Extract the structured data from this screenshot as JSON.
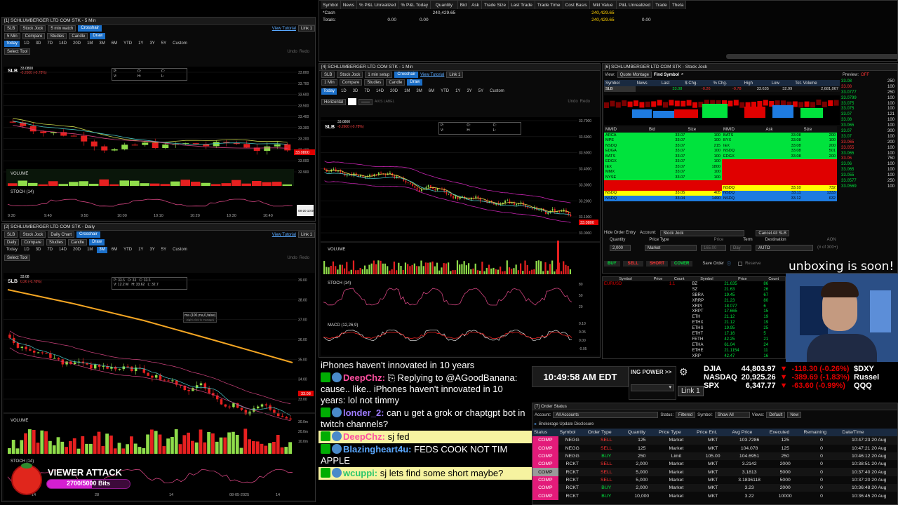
{
  "positions": {
    "headers": [
      "Symbol",
      "News",
      "% P&L Unrealized",
      "% P&L Today",
      "Quantity",
      "Bid",
      "Ask",
      "Trade Size",
      "Last Trade",
      "Trade Time",
      "Cost Basis",
      "Mkt Value",
      "P&L Unrealized",
      "Trade",
      "Theta"
    ],
    "rows": [
      {
        "symbol": "*Cash",
        "qty": "240,429.65",
        "mkt": "240,429.65",
        "pl": ""
      },
      {
        "symbol": "Totals:",
        "pu": "0.00",
        "pt": "0.00",
        "mkt": "240,429.65",
        "pl": "0.00"
      }
    ]
  },
  "chart1": {
    "title": "[1] SCHLUMBERGER LTD COM STK - 5 Min",
    "symbol": "SLB",
    "setup": "Stock Jock",
    "interval": "5 min watch",
    "crosshair": "Crosshair",
    "tutorial": "View Tutorial",
    "link": "Link 1",
    "tb2": [
      "5 Min",
      "Compare",
      "Studies",
      "Candle",
      "Draw"
    ],
    "tfs": [
      "Today",
      "1D",
      "3D",
      "7D",
      "14D",
      "20D",
      "1M",
      "3M",
      "6M",
      "YTD",
      "1Y",
      "3Y",
      "5Y",
      "Custom"
    ],
    "select_tool": "Select Tool",
    "undo": "Undo",
    "redo": "Redo",
    "price": "33.0800",
    "change": "-0.2600 (-0.78%)",
    "ohlc": [
      "P:",
      "O:",
      "C:",
      "V:",
      "H:",
      "L:"
    ],
    "yticks": [
      "33.800",
      "33.700",
      "33.600",
      "33.500",
      "33.400",
      "33.300",
      "33.200",
      "33.100",
      "33.000",
      "32.900"
    ],
    "last": "33.0800",
    "volume_label": "VOLUME",
    "stoch_label": "STOCH (14)",
    "xticks": [
      "9:30",
      "9:40",
      "9:50",
      "10:00",
      "10:10",
      "10:20",
      "10:30",
      "10:40"
    ],
    "time_badge": "08-20 10:50"
  },
  "chart2": {
    "title": "[2] SCHLUMBERGER LTD COM STK - Daily",
    "symbol": "SLB",
    "setup": "Stock Jock",
    "interval": "Daily Chart",
    "crosshair": "Crosshair",
    "tutorial": "View Tutorial",
    "link": "Link 1",
    "tb2": [
      "Daily",
      "Compare",
      "Studies",
      "Candle",
      "Draw"
    ],
    "tfs": [
      "Today",
      "1D",
      "3D",
      "7D",
      "14D",
      "20D",
      "1M",
      "3M",
      "6M",
      "YTD",
      "1Y",
      "3Y",
      "5Y",
      "Custom"
    ],
    "select_tool": "Select Tool",
    "undo": "Undo",
    "redo": "Redo",
    "price": "33.08",
    "change": "0.26 (-0.78%)",
    "ohlc": "P: 33.5   O: 33   C: 33.5\nV: 12.2 M   H: 33.62   L: 32.7",
    "ma_label": "ma (100,ma,0,false)",
    "ma_hint": "(right-click to manage)",
    "yticks": [
      "39.00",
      "38.00",
      "37.00",
      "36.00",
      "35.00",
      "34.00",
      "33.00"
    ],
    "last": "33.08",
    "volume_label": "VOLUME",
    "stoch_label": "STOCH (14)",
    "vol_ticks": [
      "30.0m",
      "20.0m",
      "10.0m"
    ],
    "xticks": [
      "14",
      "28",
      "14",
      "08-05-2025",
      "14"
    ]
  },
  "chart4": {
    "title": "[4] SCHLUMBERGER LTD COM STK - 1 Min",
    "symbol": "SLB",
    "setup": "Stock Jock",
    "interval": "1 min setup",
    "crosshair": "Crosshair",
    "tutorial": "View Tutorial",
    "link": "Link 1",
    "tb2": [
      "1 Min",
      "Compare",
      "Studies",
      "Candle",
      "Draw"
    ],
    "tfs": [
      "Today",
      "1D",
      "3D",
      "7D",
      "14D",
      "20D",
      "1M",
      "3M",
      "6M",
      "YTD",
      "1Y",
      "3Y",
      "5Y",
      "Custom"
    ],
    "line_style": "Horizontal",
    "axis_label": "AXIS LABEL",
    "undo": "Undo",
    "redo": "Redo",
    "price": "33.0800",
    "change": "-0.2600 (-0.78%)",
    "ohlc": [
      "P:",
      "O:",
      "C:",
      "V:",
      "H:",
      "L:"
    ],
    "yticks": [
      "33.7000",
      "33.6000",
      "33.5000",
      "33.4000",
      "33.3000",
      "33.2000",
      "33.1000",
      "33.0000"
    ],
    "last": "33.0800",
    "volume_label": "VOLUME",
    "stoch_label": "STOCH (14)",
    "macd_label": "MACD (12,26,9)",
    "stoch_ticks": [
      "80",
      "50",
      "20"
    ],
    "macd_ticks": [
      "0.10",
      "0.05",
      "0.00",
      "-0.05"
    ]
  },
  "level2": {
    "title": "[6] SCHLUMBERGER LTD COM STK - Stock Jock",
    "view": "Quote Montage",
    "find": "Find Symbol",
    "preview": "Preview:",
    "preview_state": "OFF",
    "quote_headers": [
      "Symbol",
      "News",
      "Last",
      "$ Chg.",
      "% Chg.",
      "High",
      "Low",
      "Tot. Volume"
    ],
    "quote": {
      "symbol": "SLB",
      "last": "33.08",
      "chg": "-0.26",
      "pct": "-0.78",
      "high": "33.635",
      "low": "32.99",
      "vol": "2,681,067"
    },
    "bid_headers": [
      "MMID",
      "Bid",
      "Size"
    ],
    "ask_headers": [
      "MMID",
      "Ask",
      "Size"
    ],
    "bids": [
      [
        "ARCA",
        "33.07",
        "100"
      ],
      [
        "MPE",
        "33.07",
        "100"
      ],
      [
        "NSDQ",
        "33.07",
        "215"
      ],
      [
        "EDGA",
        "33.07",
        "100"
      ],
      [
        "BATS",
        "33.07",
        "100"
      ],
      [
        "EDGX",
        "33.07",
        "100"
      ],
      [
        "IEX",
        "33.07",
        "1800"
      ],
      [
        "MMX",
        "33.07",
        "100"
      ],
      [
        "NYSE",
        "33.07",
        "100"
      ],
      [
        "",
        "",
        ""
      ],
      [
        "",
        "",
        ""
      ],
      [
        "NSDQ",
        "33.05",
        "405"
      ],
      [
        "NSDQ",
        "33.04",
        "1490"
      ]
    ],
    "asks": [
      [
        "BATS",
        "33.08",
        "200"
      ],
      [
        "BYX",
        "33.08",
        "100"
      ],
      [
        "IEX",
        "33.08",
        "200"
      ],
      [
        "NSDQ",
        "33.08",
        "501"
      ],
      [
        "EDGX",
        "33.08",
        "200"
      ],
      [
        "",
        "",
        ""
      ],
      [
        "",
        "",
        ""
      ],
      [
        "",
        "",
        ""
      ],
      [
        "",
        "",
        ""
      ],
      [
        "",
        "",
        ""
      ],
      [
        "NSDQ",
        "33.10",
        "732"
      ],
      [
        "NSDQ",
        "33.11",
        "1333"
      ],
      [
        "NSDQ",
        "33.12",
        "632"
      ]
    ],
    "ticks": [
      [
        "33.08",
        "250"
      ],
      [
        "33.08",
        "100"
      ],
      [
        "33.0777",
        "250"
      ],
      [
        "33.0799",
        "100"
      ],
      [
        "33.075",
        "100"
      ],
      [
        "33.075",
        "100"
      ],
      [
        "33.07",
        "121"
      ],
      [
        "33.08",
        "100"
      ],
      [
        "33.065",
        "100"
      ],
      [
        "33.07",
        "300"
      ],
      [
        "33.07",
        "100"
      ],
      [
        "33.065",
        "200"
      ],
      [
        "33.055",
        "100"
      ],
      [
        "33.065",
        "100"
      ],
      [
        "33.06",
        "750"
      ],
      [
        "33.06",
        "100"
      ],
      [
        "33.065",
        "100"
      ],
      [
        "33.055",
        "100"
      ],
      [
        "33.0577",
        "250"
      ],
      [
        "33.0569",
        "100"
      ]
    ],
    "entry": {
      "hide": "Hide Order Entry",
      "account_label": "Account:",
      "account": "Stock Jock",
      "cancel": "Cancel All SLB",
      "qty_label": "Quantity",
      "qty": "2,000",
      "ptype_label": "Price Type",
      "ptype": "Market",
      "price_label": "Price",
      "price": "165.00",
      "term_label": "Term",
      "term": "Day",
      "dest_label": "Destination",
      "dest": "AUTO",
      "aon": "AON",
      "of": "(# of 300+)",
      "buy": "BUY",
      "sell": "SELL",
      "short": "SHORT",
      "cover": "COVER",
      "save": "Save Order",
      "reserve": "Reserve"
    }
  },
  "watch": {
    "headers": [
      "Symbol",
      "Price",
      "Count",
      "Symbol",
      "Price",
      "Count"
    ],
    "left": [
      [
        "EURUSD",
        "",
        "1.1"
      ],
      [
        "",
        "",
        ""
      ],
      [
        "",
        "",
        ""
      ],
      [
        "",
        "",
        ""
      ],
      [
        "",
        "",
        ""
      ],
      [
        "",
        "",
        ""
      ],
      [
        "",
        "",
        ""
      ],
      [
        "",
        "",
        ""
      ],
      [
        "",
        "",
        ""
      ],
      [
        "",
        "",
        ""
      ],
      [
        "",
        "",
        ""
      ],
      [
        "",
        "",
        ""
      ],
      [
        "",
        "",
        ""
      ],
      [
        "",
        "",
        ""
      ],
      [
        "",
        "",
        ""
      ]
    ],
    "right": [
      [
        "BZ",
        "21.635",
        "86"
      ],
      [
        "SZ",
        "21.63",
        "26"
      ],
      [
        "SBRA",
        "19.45",
        "67"
      ],
      [
        "XRRP",
        "21.23",
        "80"
      ],
      [
        "XRPI",
        "18.077",
        "6"
      ],
      [
        "XRPT",
        "17.665",
        "15"
      ],
      [
        "ETH",
        "21.12",
        "19"
      ],
      [
        "ETHX",
        "21.12",
        "19"
      ],
      [
        "ETHS",
        "19.95",
        "25"
      ],
      [
        "ETHT",
        "17.16",
        "5"
      ],
      [
        "FETH",
        "42.25",
        "21"
      ],
      [
        "ETHA",
        "61.04",
        "24"
      ],
      [
        "ETHE",
        "21.1154",
        "11"
      ],
      [
        "XRP",
        "42.47",
        "16"
      ]
    ]
  },
  "overlay": {
    "caption": "unboxing is soon!"
  },
  "chat": [
    {
      "user": "",
      "text": "iPhones haven't innovated in 10 years",
      "plain": true
    },
    {
      "user": "DeepChz:",
      "reply": "Replying to @AGoodBanana: cause.. like.. iPhones haven't innovated in 10 years:",
      "text": " lol not timmy",
      "ucolor": "#ff4fa0"
    },
    {
      "user": "londer_2:",
      "text": " can u get a grok or chaptgpt bot in twitch channels?",
      "ucolor": "#9f7cff"
    },
    {
      "user": "DeepChz:",
      "text": " sj fed",
      "ucolor": "#ff4fa0",
      "hl": true
    },
    {
      "user": "Blazingheart4u:",
      "text": " FEDS COOK NOT TIM APPLE",
      "ucolor": "#5aa8ff"
    },
    {
      "user": "wcuppi:",
      "text": " sj lets find some short maybe?",
      "ucolor": "#2cc66b",
      "hl": true
    }
  ],
  "clock": "10:49:58 AM EDT",
  "buying_power": "ING POWER >>",
  "link_btn": "Link 1",
  "indices": [
    {
      "name": "DJIA",
      "val": "44,803.97",
      "chg": "-118.30 (-0.26%)",
      "side": "$DXY"
    },
    {
      "name": "NASDAQ",
      "val": "20,925.26",
      "chg": "-389.69 (-1.83%)",
      "side": "Russel"
    },
    {
      "name": "SPX",
      "val": "6,347.77",
      "chg": "-63.60 (-0.99%)",
      "side": "QQQ"
    }
  ],
  "orders": {
    "title": "[7] Order Status",
    "account_label": "Account:",
    "account": "All Accounts",
    "status_label": "Status:",
    "status": "Filtered",
    "symbol_label": "Symbol:",
    "symbol": "Show All",
    "views_label": "Views:",
    "views": "Default",
    "new": "New",
    "disclosure": "Brokerage Update Disclosure",
    "headers": [
      "Status",
      "Symbol",
      "Order Type",
      "Quantity",
      "Price Type",
      "Price Ent.",
      "Avg Price",
      "Executed",
      "Remaining",
      "Date/Time"
    ],
    "rows": [
      [
        "COMP",
        "NEGG",
        "SELL",
        "125",
        "Market",
        "MKT",
        "103.7286",
        "125",
        "0",
        "10:47:23 20 Aug"
      ],
      [
        "COMP",
        "NEGG",
        "SELL",
        "125",
        "Market",
        "MKT",
        "104.078",
        "125",
        "0",
        "10:47:21 20 Aug"
      ],
      [
        "COMP",
        "NEGG",
        "BUY",
        "250",
        "Limit",
        "105.00",
        "104.6951",
        "250",
        "0",
        "10:46:12 20 Aug"
      ],
      [
        "COMP",
        "RCKT",
        "SELL",
        "2,000",
        "Market",
        "MKT",
        "3.2142",
        "2000",
        "0",
        "10:38:51 20 Aug"
      ],
      [
        "COMP",
        "RCKT",
        "SELL",
        "5,000",
        "Market",
        "MKT",
        "3.1813",
        "5000",
        "0",
        "10:37:40 20 Aug"
      ],
      [
        "COMP",
        "RCKT",
        "SELL",
        "5,000",
        "Market",
        "MKT",
        "3.1836118",
        "5000",
        "0",
        "10:37:20 20 Aug"
      ],
      [
        "COMP",
        "RCKT",
        "BUY",
        "2,000",
        "Market",
        "MKT",
        "3.23",
        "2000",
        "0",
        "10:36:48 20 Aug"
      ],
      [
        "COMP",
        "RCKT",
        "BUY",
        "10,000",
        "Market",
        "MKT",
        "3.22",
        "10000",
        "0",
        "10:36:45 20 Aug"
      ]
    ]
  },
  "alert": {
    "title": "VIEWER ATTACK",
    "progress_text": "2700/5000 Bits",
    "progress": 0.54
  },
  "colors": {
    "green": "#00e33d",
    "red": "#e00000",
    "yellow": "#ffff00",
    "blue": "#1b6fc8",
    "orange": "#f5a623",
    "magenta": "#c724b1"
  }
}
